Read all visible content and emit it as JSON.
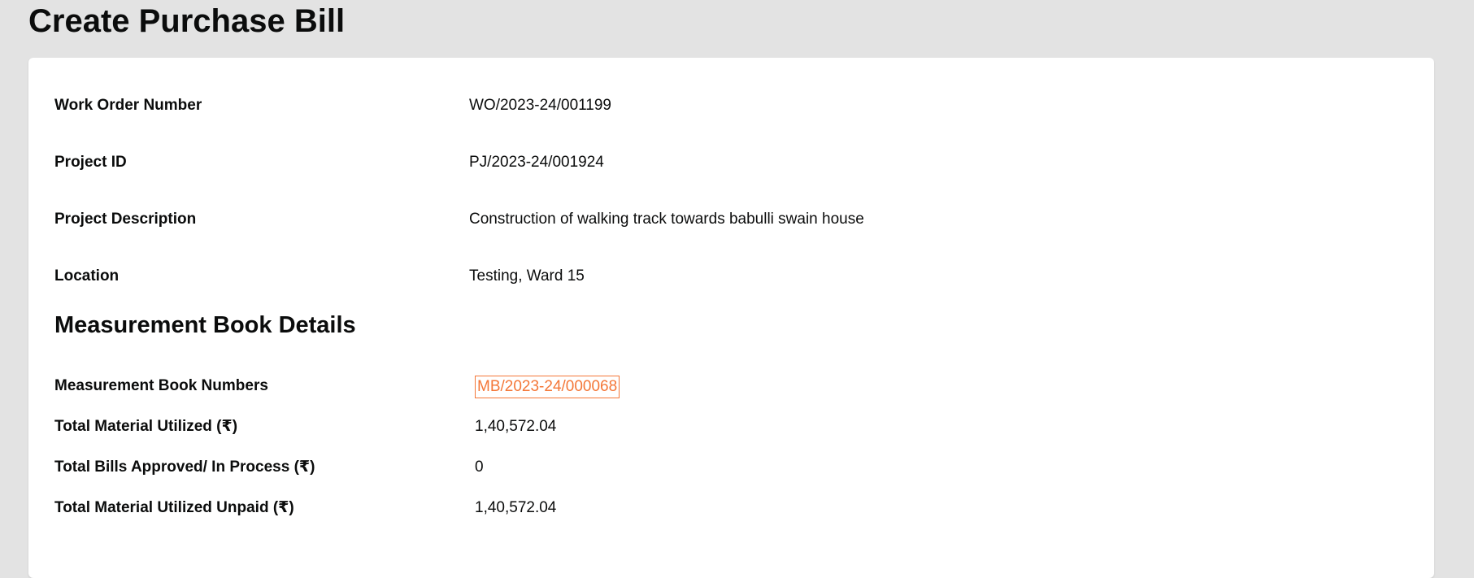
{
  "page": {
    "title": "Create Purchase Bill"
  },
  "work_order": {
    "rows": [
      {
        "label": "Work Order Number",
        "value": "WO/2023-24/001199"
      },
      {
        "label": "Project ID",
        "value": "PJ/2023-24/001924"
      },
      {
        "label": "Project Description",
        "value": "Construction of walking track towards babulli swain house"
      },
      {
        "label": "Location",
        "value": "Testing, Ward 15"
      }
    ]
  },
  "measurement_book": {
    "section_title": "Measurement Book Details",
    "numbers_label": "Measurement Book Numbers",
    "numbers_link": "MB/2023-24/000068",
    "link_color": "#f47738",
    "rows": [
      {
        "label": "Total Material Utilized (₹)",
        "value": "1,40,572.04"
      },
      {
        "label": "Total Bills Approved/ In Process (₹)",
        "value": "0"
      },
      {
        "label": "Total Material Utilized Unpaid (₹)",
        "value": "1,40,572.04"
      }
    ]
  }
}
